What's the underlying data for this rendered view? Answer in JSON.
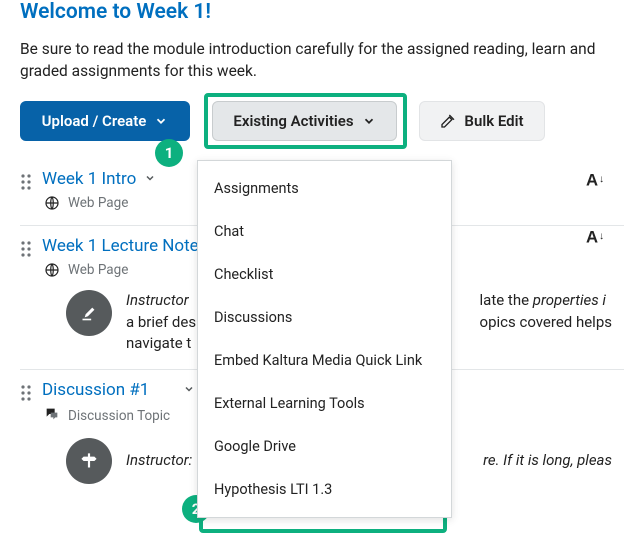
{
  "title": "Welcome to Week 1!",
  "intro": "Be sure to read the module introduction carefully for the assigned reading, learn and graded assignments for this week.",
  "toolbar": {
    "upload_label": "Upload / Create",
    "existing_label": "Existing Activities",
    "bulk_label": "Bulk Edit"
  },
  "menu": {
    "items": [
      "Assignments",
      "Chat",
      "Checklist",
      "Discussions",
      "Embed Kaltura Media Quick Link",
      "External Learning Tools",
      "Google Drive",
      "Hypothesis LTI 1.3"
    ]
  },
  "callouts": {
    "one": "1",
    "two": "2"
  },
  "topics": [
    {
      "title": "Week 1 Intro",
      "type": "Web Page",
      "type_icon": "globe",
      "desc_html": ""
    },
    {
      "title": "Week 1 Lecture Note",
      "type": "Web Page",
      "type_icon": "globe",
      "desc_prefix_italic": "Instructor",
      "desc_middle": " a brief des",
      "desc_break": " navigate t",
      "desc_right1": "late the ",
      "desc_right1_italic": "properties i",
      "desc_right2": "opics covered helps "
    },
    {
      "title": "Discussion #1",
      "type": "Discussion Topic",
      "type_icon": "discussion",
      "desc_prefix_italic": "Instructor:",
      "desc_right_italic": "re. If it is long, pleas"
    }
  ]
}
